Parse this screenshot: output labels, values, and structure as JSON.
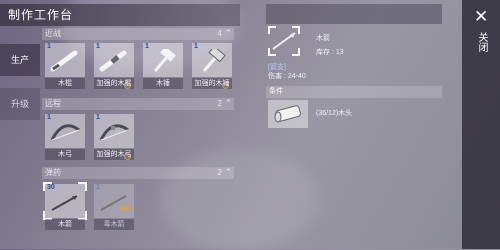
{
  "title": "制作工作台",
  "tabs": [
    {
      "label": "生产",
      "active": true
    },
    {
      "label": "升级",
      "active": false
    }
  ],
  "categories": [
    {
      "name": "近战",
      "count": "4",
      "items": [
        {
          "num": "1",
          "label": "木棍",
          "star": false
        },
        {
          "num": "1",
          "label": "加强的木棍",
          "star": true
        },
        {
          "num": "1",
          "label": "木锤",
          "star": false
        },
        {
          "num": "1",
          "label": "加强的木锤",
          "star": true
        }
      ]
    },
    {
      "name": "远程",
      "count": "2",
      "items": [
        {
          "num": "1",
          "label": "木弓",
          "star": false
        },
        {
          "num": "1",
          "label": "加强的木弓",
          "star": true
        }
      ]
    },
    {
      "name": "弹药",
      "count": "2",
      "items": [
        {
          "num": "30",
          "label": "木箭",
          "star": false,
          "selected": true
        },
        {
          "num": "1",
          "label": "毒木箭",
          "star": true,
          "dim": true
        }
      ]
    }
  ],
  "detail": {
    "name": "木箭",
    "stock": "库存 : 13",
    "tag": "[箭支]",
    "damage": "伤害 : 24-40",
    "condition_label": "条件",
    "material": "(36/12)木头"
  },
  "close_label": "关闭",
  "close_symbol": "✕",
  "chevron": "⌃"
}
